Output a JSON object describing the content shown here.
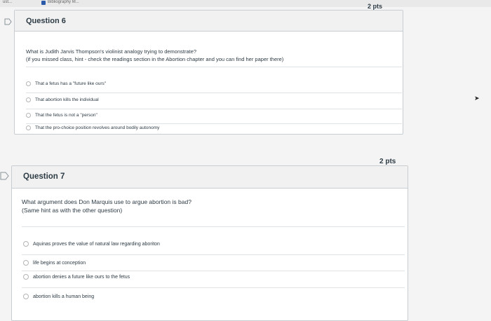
{
  "browser": {
    "tab_fragment": "ust...",
    "tab_label": "Bibliography M..."
  },
  "question6": {
    "title": "Question 6",
    "points": "2 pts",
    "prompt_line1": "What is Judith Jarvis Thompson's violinist analogy trying to demonstrate?",
    "prompt_line2": "(if you missed class, hint - check the readings section in the Abortion chapter and you can find her paper there)",
    "answers": [
      "That a fetus has a \"future like ours\"",
      "That abortion kills the individual",
      "That the fetus is not a \"person\"",
      "That the pro-choice position revolves around bodily autonomy"
    ]
  },
  "question7": {
    "title": "Question 7",
    "points": "2 pts",
    "prompt_line1": "What argument does Don Marquis use to argue abortion is bad?",
    "prompt_line2": "(Same hint as with the other question)",
    "answers": [
      "Aquinas proves the value of natural law regarding aboriton",
      "life begins at conception",
      "abortion denies a future like ours to the fetus",
      "abortion kills a human being"
    ]
  },
  "colors": {
    "card_border": "#c7cdd1",
    "header_bg": "#f1f1f1",
    "text": "#2d3b45",
    "page_bg": "#f4f4f4"
  }
}
